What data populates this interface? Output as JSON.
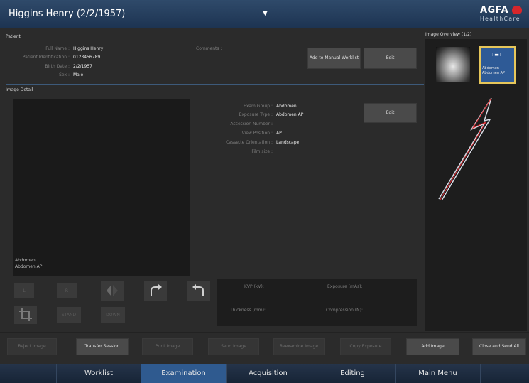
{
  "header": {
    "title": "Higgins Henry (2/2/1957)",
    "brand": "AGFA",
    "brand_sub": "HealthCare"
  },
  "patient": {
    "section": "Patient",
    "full_name_label": "Full Name :",
    "full_name": "Higgins Henry",
    "id_label": "Patient Identification :",
    "id": "0123456789",
    "birth_label": "Birth Date :",
    "birth": "2/2/1957",
    "sex_label": "Sex :",
    "sex": "Male",
    "comments_label": "Comments :",
    "add_worklist": "Add to Manual Worklist",
    "edit": "Edit"
  },
  "image_detail": {
    "section": "Image Detail",
    "exam_group_label": "Exam Group :",
    "exam_group": "Abdomen",
    "exposure_type_label": "Exposure Type :",
    "exposure_type": "Abdomen AP",
    "accession_label": "Accession Number :",
    "view_position_label": "View Position :",
    "view_position": "AP",
    "cassette_label": "Cassette Orientation :",
    "cassette": "Landscape",
    "film_size_label": "Film size :",
    "edit": "Edit",
    "caption1": "Abdomen",
    "caption2": "Abdomen AP"
  },
  "tools": {
    "l": "L",
    "r": "R",
    "stand": "STAND",
    "down": "DOWN"
  },
  "measure": {
    "kvp": "KVP (kV):",
    "exposure": "Exposure (mAs):",
    "thickness": "Thickness (mm):",
    "compression": "Compression (N):"
  },
  "overview": {
    "title": "Image Overview (1/2)",
    "thumb2_line1": "Abdomen",
    "thumb2_line2": "Abdomen AP"
  },
  "actions": [
    "Reject Image",
    "Transfer Session",
    "Print Image",
    "Send Image",
    "Reexamine Image",
    "Copy Exposure",
    "Add Image",
    "Close and Send All"
  ],
  "nav": [
    "Worklist",
    "Examination",
    "Acquisition",
    "Editing",
    "Main Menu"
  ]
}
